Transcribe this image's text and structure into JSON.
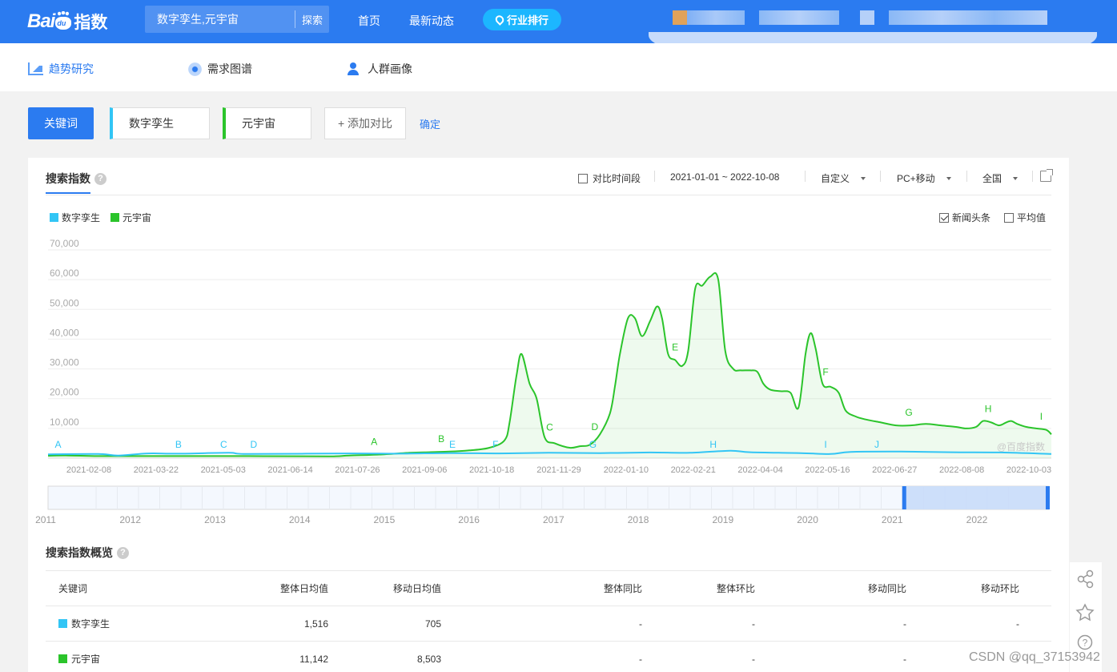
{
  "header": {
    "logo_text_a": "Bai",
    "logo_text_b": "du",
    "logo_text_c": "指数",
    "search_value": "数字孪生,元宇宙",
    "search_button": "探索",
    "nav": [
      "首页",
      "最新动态"
    ],
    "rank_button": "行业排行"
  },
  "subnav": {
    "tabs": [
      {
        "label": "趋势研究",
        "icon": "trend-icon",
        "active": true
      },
      {
        "label": "需求图谱",
        "icon": "target-icon",
        "active": false
      },
      {
        "label": "人群画像",
        "icon": "person-icon",
        "active": false
      }
    ]
  },
  "keywords": {
    "button": "关键词",
    "items": [
      {
        "label": "数字孪生",
        "color": "#32c5f5"
      },
      {
        "label": "元宇宙",
        "color": "#2bc42b"
      }
    ],
    "add": "+ 添加对比",
    "confirm": "确定"
  },
  "panel": {
    "title": "搜索指数",
    "help": "?",
    "compare_period": "对比时间段",
    "date_range": "2021-01-01 ~ 2022-10-08",
    "custom": "自定义",
    "device": "PC+移动",
    "region": "全国",
    "news": "新闻头条",
    "average": "平均值",
    "watermark": "@百度指数"
  },
  "chart_data": {
    "type": "line",
    "title": "",
    "xlabel": "",
    "ylabel": "",
    "ylim": [
      0,
      70000
    ],
    "yticks": [
      "70,000",
      "60,000",
      "50,000",
      "40,000",
      "30,000",
      "20,000",
      "10,000"
    ],
    "xticks": [
      "2021-02-08",
      "2021-03-22",
      "2021-05-03",
      "2021-06-14",
      "2021-07-26",
      "2021-09-06",
      "2021-10-18",
      "2021-11-29",
      "2022-01-10",
      "2022-02-21",
      "2022-04-04",
      "2022-05-16",
      "2022-06-27",
      "2022-08-08",
      "2022-10-03"
    ],
    "series": [
      {
        "name": "数字孪生",
        "color": "#32c5f5",
        "points": [
          [
            0,
            1300
          ],
          [
            0.05,
            1400
          ],
          [
            0.07,
            900
          ],
          [
            0.1,
            1600
          ],
          [
            0.13,
            1500
          ],
          [
            0.18,
            1800
          ],
          [
            0.2,
            1400
          ],
          [
            0.3,
            1600
          ],
          [
            0.35,
            1500
          ],
          [
            0.4,
            1700
          ],
          [
            0.45,
            1600
          ],
          [
            0.5,
            1800
          ],
          [
            0.55,
            1700
          ],
          [
            0.6,
            1900
          ],
          [
            0.64,
            1800
          ],
          [
            0.68,
            2500
          ],
          [
            0.7,
            2000
          ],
          [
            0.75,
            1700
          ],
          [
            0.78,
            1400
          ],
          [
            0.8,
            2100
          ],
          [
            0.85,
            2200
          ],
          [
            0.9,
            2000
          ],
          [
            0.95,
            1900
          ],
          [
            1,
            1400
          ]
        ]
      },
      {
        "name": "元宇宙",
        "color": "#2bc42b",
        "points": [
          [
            0,
            800
          ],
          [
            0.02,
            900
          ],
          [
            0.05,
            700
          ],
          [
            0.1,
            700
          ],
          [
            0.2,
            700
          ],
          [
            0.28,
            600
          ],
          [
            0.3,
            900
          ],
          [
            0.33,
            1200
          ],
          [
            0.36,
            1800
          ],
          [
            0.38,
            2000
          ],
          [
            0.4,
            2200
          ],
          [
            0.42,
            2600
          ],
          [
            0.44,
            3500
          ],
          [
            0.455,
            6000
          ],
          [
            0.46,
            12000
          ],
          [
            0.467,
            28000
          ],
          [
            0.472,
            35000
          ],
          [
            0.48,
            25000
          ],
          [
            0.487,
            20000
          ],
          [
            0.495,
            7000
          ],
          [
            0.505,
            5000
          ],
          [
            0.52,
            3500
          ],
          [
            0.53,
            4000
          ],
          [
            0.54,
            4500
          ],
          [
            0.55,
            8000
          ],
          [
            0.56,
            15000
          ],
          [
            0.565,
            24000
          ],
          [
            0.57,
            35000
          ],
          [
            0.578,
            47000
          ],
          [
            0.585,
            47000
          ],
          [
            0.592,
            41000
          ],
          [
            0.6,
            46000
          ],
          [
            0.607,
            51000
          ],
          [
            0.612,
            47000
          ],
          [
            0.618,
            35000
          ],
          [
            0.625,
            33000
          ],
          [
            0.632,
            31000
          ],
          [
            0.638,
            36000
          ],
          [
            0.645,
            57000
          ],
          [
            0.652,
            58000
          ],
          [
            0.66,
            61000
          ],
          [
            0.668,
            60000
          ],
          [
            0.675,
            36000
          ],
          [
            0.683,
            30000
          ],
          [
            0.69,
            29500
          ],
          [
            0.7,
            29500
          ],
          [
            0.707,
            29000
          ],
          [
            0.713,
            25000
          ],
          [
            0.72,
            23000
          ],
          [
            0.73,
            22500
          ],
          [
            0.74,
            22000
          ],
          [
            0.748,
            17000
          ],
          [
            0.755,
            35000
          ],
          [
            0.76,
            42000
          ],
          [
            0.765,
            37000
          ],
          [
            0.772,
            25000
          ],
          [
            0.78,
            24000
          ],
          [
            0.788,
            22000
          ],
          [
            0.795,
            16000
          ],
          [
            0.805,
            14000
          ],
          [
            0.815,
            13000
          ],
          [
            0.83,
            12000
          ],
          [
            0.845,
            11000
          ],
          [
            0.86,
            11000
          ],
          [
            0.875,
            11500
          ],
          [
            0.89,
            11000
          ],
          [
            0.905,
            10500
          ],
          [
            0.915,
            10000
          ],
          [
            0.925,
            10500
          ],
          [
            0.932,
            12500
          ],
          [
            0.94,
            12000
          ],
          [
            0.948,
            11000
          ],
          [
            0.955,
            12000
          ],
          [
            0.96,
            12500
          ],
          [
            0.966,
            11500
          ],
          [
            0.975,
            10500
          ],
          [
            0.985,
            10000
          ],
          [
            0.995,
            9500
          ],
          [
            1,
            8000
          ]
        ]
      }
    ],
    "annotations": [
      {
        "series": 0,
        "label": "A",
        "x": 0.01
      },
      {
        "series": 0,
        "label": "B",
        "x": 0.13
      },
      {
        "series": 0,
        "label": "C",
        "x": 0.175
      },
      {
        "series": 0,
        "label": "D",
        "x": 0.205
      },
      {
        "series": 1,
        "label": "A",
        "x": 0.325
      },
      {
        "series": 1,
        "label": "B",
        "x": 0.392
      },
      {
        "series": 0,
        "label": "E",
        "x": 0.403
      },
      {
        "series": 0,
        "label": "F",
        "x": 0.446
      },
      {
        "series": 1,
        "label": "C",
        "x": 0.5
      },
      {
        "series": 1,
        "label": "D",
        "x": 0.545
      },
      {
        "series": 0,
        "label": "G",
        "x": 0.543
      },
      {
        "series": 1,
        "label": "E",
        "x": 0.625
      },
      {
        "series": 0,
        "label": "H",
        "x": 0.663
      },
      {
        "series": 1,
        "label": "F",
        "x": 0.775
      },
      {
        "series": 0,
        "label": "I",
        "x": 0.775
      },
      {
        "series": 0,
        "label": "J",
        "x": 0.826
      },
      {
        "series": 1,
        "label": "G",
        "x": 0.858
      },
      {
        "series": 1,
        "label": "H",
        "x": 0.937
      },
      {
        "series": 1,
        "label": "I",
        "x": 0.99
      }
    ],
    "grid": true
  },
  "navigator": {
    "years": [
      "2011",
      "2012",
      "2013",
      "2014",
      "2015",
      "2016",
      "2017",
      "2018",
      "2019",
      "2020",
      "2021",
      "2022"
    ],
    "selection": [
      0.855,
      1.0
    ]
  },
  "summary": {
    "title": "搜索指数概览",
    "columns": [
      "关键词",
      "整体日均值",
      "移动日均值",
      "整体同比",
      "整体环比",
      "移动同比",
      "移动环比"
    ],
    "rows": [
      {
        "keyword": "数字孪生",
        "color": "#32c5f5",
        "values": [
          "1,516",
          "705",
          "-",
          "-",
          "-",
          "-"
        ]
      },
      {
        "keyword": "元宇宙",
        "color": "#2bc42b",
        "values": [
          "11,142",
          "8,503",
          "-",
          "-",
          "-",
          "-"
        ]
      }
    ]
  },
  "sidebar_icons": [
    "share-icon",
    "star-icon",
    "help-icon"
  ],
  "credit": "CSDN @qq_37153942"
}
